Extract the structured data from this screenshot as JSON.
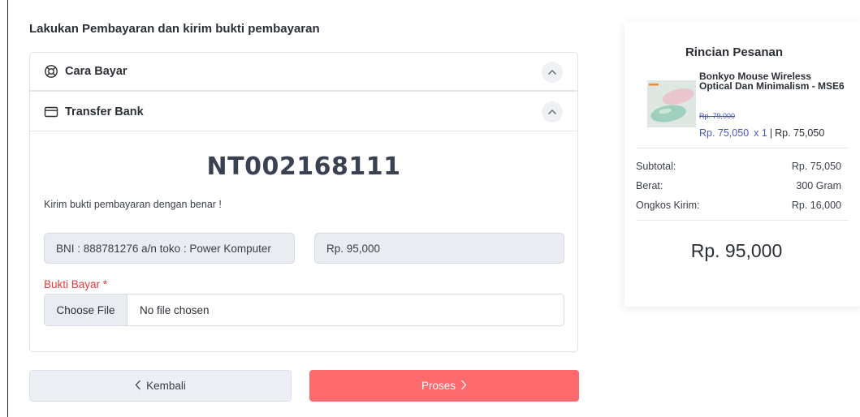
{
  "page": {
    "title": "Lakukan Pembayaran dan kirim bukti pembayaran"
  },
  "payment": {
    "section_how_label": "Cara Bayar",
    "section_transfer_label": "Transfer Bank",
    "va_code": "NT002168111",
    "instruction": "Kirim bukti pembayaran dengan benar !",
    "bank_account": "BNI : 888781276 a/n toko : Power Komputer",
    "amount": "Rp. 95,000",
    "upload_label": "Bukti Bayar *",
    "file_button": "Choose File",
    "file_status": "No file chosen"
  },
  "actions": {
    "back_label": "Kembali",
    "submit_label": "Proses"
  },
  "summary": {
    "title": "Rincian Pesanan",
    "product": {
      "name": "Bonkyo Mouse Wireless Optical Dan Minimalism - MSE6",
      "old_price": "Rp. 79,000",
      "price": "Rp. 75,050",
      "qty": "x 1",
      "line_total": "Rp. 75,050"
    },
    "subtotal_label": "Subtotal:",
    "subtotal_value": "Rp. 75,050",
    "weight_label": "Berat:",
    "weight_value": "300 Gram",
    "shipping_label": "Ongkos Kirim:",
    "shipping_value": "Rp. 16,000",
    "total": "Rp. 95,000"
  },
  "icons": {
    "section_how": "lifebuoy-icon",
    "section_transfer": "credit-card-icon",
    "collapse": "chevron-up-icon",
    "back": "chevron-left-icon",
    "next": "chevron-right-icon"
  },
  "colors": {
    "accent_button": "#fc6a6d",
    "required_label": "#e23b3b",
    "price_link": "#4a55b8"
  }
}
